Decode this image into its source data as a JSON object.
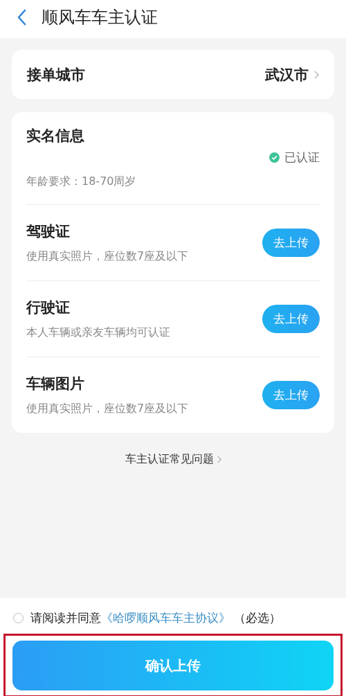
{
  "header": {
    "title": "顺风车车主认证"
  },
  "city": {
    "label": "接单城市",
    "value": "武汉市"
  },
  "identity": {
    "title": "实名信息",
    "status": "已认证",
    "verified": true,
    "note": "年龄要求：18-70周岁"
  },
  "documents": [
    {
      "title": "驾驶证",
      "hint": "使用真实照片，座位数7座及以下",
      "button": "去上传"
    },
    {
      "title": "行驶证",
      "hint": "本人车辆或亲友车辆均可认证",
      "button": "去上传"
    },
    {
      "title": "车辆图片",
      "hint": "使用真实照片，座位数7座及以下",
      "button": "去上传"
    }
  ],
  "faq_link": "车主认证常见问题",
  "agreement": {
    "checked": false,
    "prefix": "请阅读并同意",
    "link": "《哈啰顺风车车主协议》",
    "suffix": "（必选）"
  },
  "confirm_button": {
    "label": "确认上传",
    "highlighted": true
  }
}
